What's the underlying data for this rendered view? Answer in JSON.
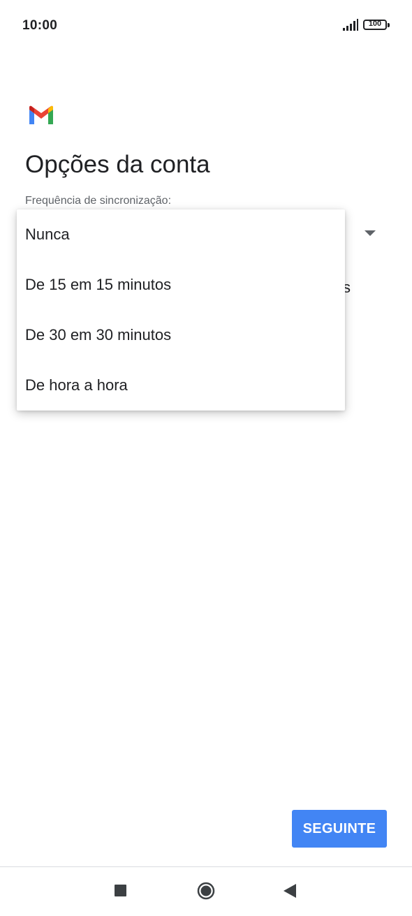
{
  "status_bar": {
    "time": "10:00",
    "battery_level": "100",
    "signal_icon": "signal-bars-icon",
    "battery_icon": "battery-icon"
  },
  "app": {
    "logo": "gmail-logo-icon",
    "title": "Opções da conta"
  },
  "sync": {
    "label": "Frequência de sincronização:",
    "options": [
      "Nunca",
      "De 15 em 15 minutos",
      "De 30 em 30 minutos",
      "De hora a hora"
    ],
    "peek_text": "s"
  },
  "actions": {
    "next_label": "SEGUINTE"
  },
  "nav_bar": {
    "recents_icon": "square-recents-icon",
    "home_icon": "circle-home-icon",
    "back_icon": "triangle-back-icon"
  },
  "colors": {
    "accent": "#4285f4",
    "gmail_red": "#ea4335",
    "gmail_blue": "#4285f4",
    "gmail_green": "#34a853",
    "gmail_yellow": "#fbbc04"
  }
}
